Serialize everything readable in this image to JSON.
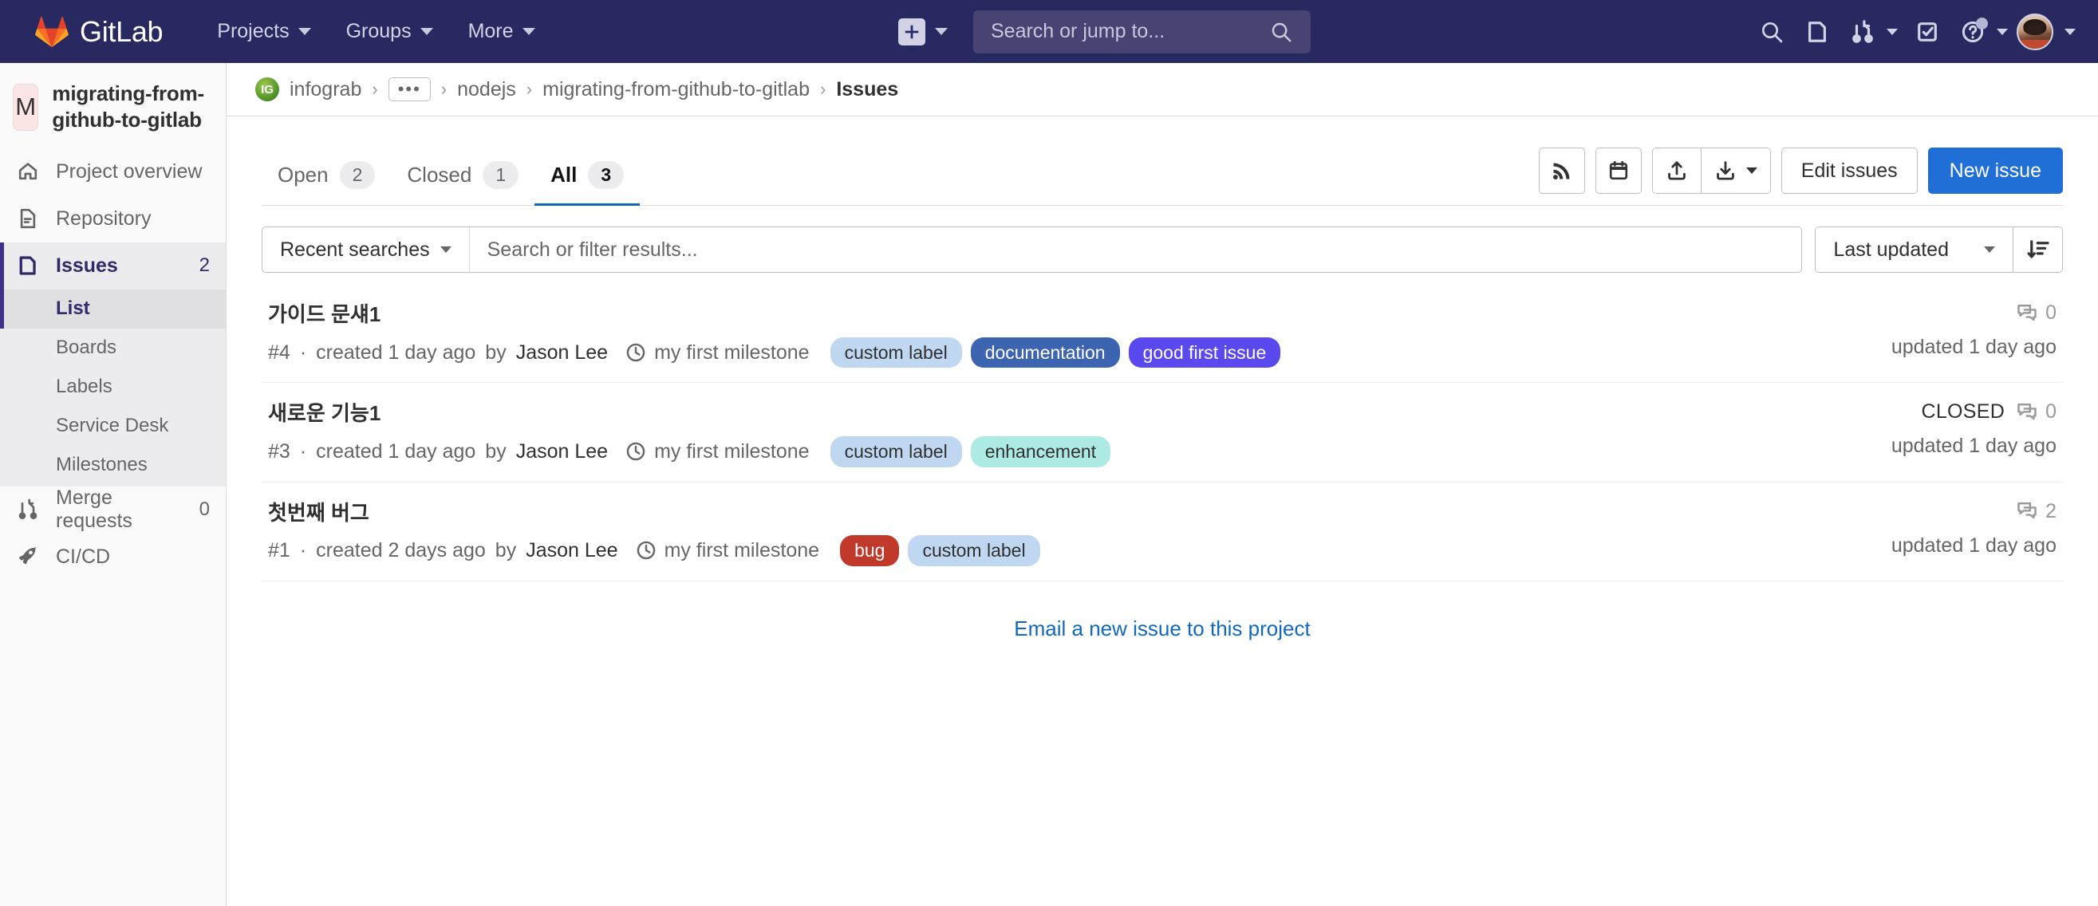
{
  "topnav": {
    "brand": "GitLab",
    "links": [
      {
        "label": "Projects",
        "name": "nav-projects"
      },
      {
        "label": "Groups",
        "name": "nav-groups"
      },
      {
        "label": "More",
        "name": "nav-more"
      }
    ],
    "plus_label": "+",
    "search_placeholder": "Search or jump to...",
    "icons": [
      "search-icon",
      "issues-icon",
      "merge-requests-icon",
      "todos-icon",
      "help-icon",
      "avatar"
    ]
  },
  "sidebar": {
    "project_initial": "M",
    "project_name": "migrating-from-github-to-gitlab",
    "items": [
      {
        "label": "Project overview",
        "icon": "home-icon",
        "badge": "",
        "active": false
      },
      {
        "label": "Repository",
        "icon": "document-icon",
        "badge": "",
        "active": false
      },
      {
        "label": "Issues",
        "icon": "issues-icon",
        "badge": "2",
        "active": true
      },
      {
        "label": "Merge requests",
        "icon": "merge-requests-icon",
        "badge": "0",
        "active": false
      },
      {
        "label": "CI/CD",
        "icon": "rocket-icon",
        "badge": "",
        "active": false
      }
    ],
    "sub_items": [
      {
        "label": "List",
        "active": true
      },
      {
        "label": "Boards",
        "active": false
      },
      {
        "label": "Labels",
        "active": false
      },
      {
        "label": "Service Desk",
        "active": false
      },
      {
        "label": "Milestones",
        "active": false
      }
    ]
  },
  "breadcrumb": {
    "group_initials": "IG",
    "items": [
      "infograb",
      "•••",
      "nodejs",
      "migrating-from-github-to-gitlab"
    ],
    "current": "Issues"
  },
  "tabs": [
    {
      "label": "Open",
      "count": "2",
      "active": false
    },
    {
      "label": "Closed",
      "count": "1",
      "active": false
    },
    {
      "label": "All",
      "count": "3",
      "active": true
    }
  ],
  "toolbar": {
    "rss_icon": "rss-icon",
    "calendar_icon": "calendar-icon",
    "import_icon": "import-icon",
    "export_icon": "export-icon",
    "edit_issues_label": "Edit issues",
    "new_issue_label": "New issue"
  },
  "filter": {
    "recent_searches_label": "Recent searches",
    "search_placeholder": "Search or filter results...",
    "sort_value": "Last updated",
    "sort_direction_icon": "sort-descending-icon"
  },
  "issues": [
    {
      "title": "가이드 문섀1",
      "reference": "#4",
      "created": "created 1 day ago",
      "author_prefix": "by",
      "author": "Jason Lee",
      "milestone": "my first milestone",
      "labels": [
        {
          "text": "custom label",
          "bg": "#bfd7f0",
          "fg": "#303030"
        },
        {
          "text": "documentation",
          "bg": "#3c64b1",
          "fg": "#ffffff"
        },
        {
          "text": "good first issue",
          "bg": "#5b49f0",
          "fg": "#ffffff"
        }
      ],
      "status": "",
      "comments": "0",
      "updated": "updated 1 day ago"
    },
    {
      "title": "새로운 기능1",
      "reference": "#3",
      "created": "created 1 day ago",
      "author_prefix": "by",
      "author": "Jason Lee",
      "milestone": "my first milestone",
      "labels": [
        {
          "text": "custom label",
          "bg": "#bfd7f0",
          "fg": "#303030"
        },
        {
          "text": "enhancement",
          "bg": "#aeeae4",
          "fg": "#303030"
        }
      ],
      "status": "CLOSED",
      "comments": "0",
      "updated": "updated 1 day ago"
    },
    {
      "title": "첫번째 버그",
      "reference": "#1",
      "created": "created 2 days ago",
      "author_prefix": "by",
      "author": "Jason Lee",
      "milestone": "my first milestone",
      "labels": [
        {
          "text": "bug",
          "bg": "#c0392b",
          "fg": "#ffffff"
        },
        {
          "text": "custom label",
          "bg": "#bfd7f0",
          "fg": "#303030"
        }
      ],
      "status": "",
      "comments": "2",
      "updated": "updated 1 day ago"
    }
  ],
  "footer": {
    "email_link": "Email a new issue to this project"
  },
  "colors": {
    "navbar_bg": "#292961",
    "primary_button": "#1f6fd6",
    "link": "#1068bf",
    "active_tab_underline": "#1068bf",
    "sidebar_active": "#2f2a6b"
  }
}
